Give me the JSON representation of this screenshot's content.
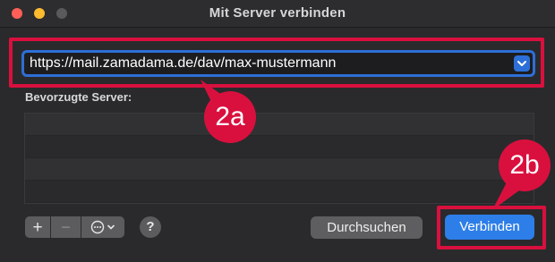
{
  "window": {
    "title": "Mit Server verbinden"
  },
  "url_field": {
    "value": "https://mail.zamadama.de/dav/max-mustermann",
    "dropdown_icon": "chevron-down-icon"
  },
  "favorites": {
    "label": "Bevorzugte Server:",
    "rows": 4
  },
  "toolbar": {
    "add_label": "+",
    "remove_label": "−",
    "action_icon": "ellipsis-circle-icon",
    "help_label": "?"
  },
  "buttons": {
    "browse_label": "Durchsuchen",
    "connect_label": "Verbinden"
  },
  "annotations": {
    "badge_2a": "2a",
    "badge_2b": "2b"
  },
  "colors": {
    "accent_blue": "#2d7ee8",
    "highlight_red": "#d9103e",
    "window_bg": "#2a2a2c"
  }
}
